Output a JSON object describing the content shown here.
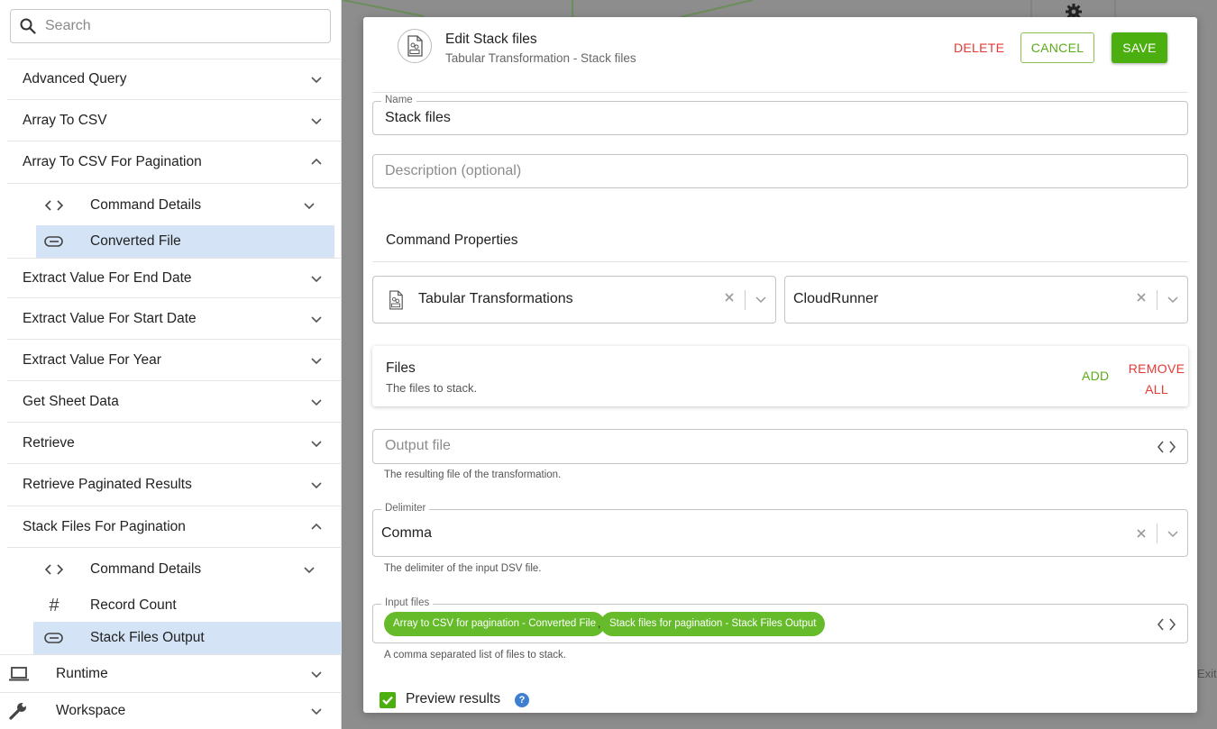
{
  "search": {
    "placeholder": "Search"
  },
  "tree": {
    "items": [
      {
        "label": "Advanced Query"
      },
      {
        "label": "Array To CSV"
      },
      {
        "label": "Array To CSV For Pagination"
      },
      {
        "label": "Command Details"
      },
      {
        "label": "Converted File"
      },
      {
        "label": "Extract Value For End Date"
      },
      {
        "label": "Extract Value For Start Date"
      },
      {
        "label": "Extract Value For Year"
      },
      {
        "label": "Get Sheet Data"
      },
      {
        "label": "Retrieve"
      },
      {
        "label": "Retrieve Paginated Results"
      },
      {
        "label": "Stack Files For Pagination"
      },
      {
        "label": "Command Details"
      },
      {
        "label": "Record Count"
      },
      {
        "label": "Stack Files Output"
      },
      {
        "label": "Runtime"
      },
      {
        "label": "Workspace"
      }
    ]
  },
  "canvas": {
    "exit_label": "Exit"
  },
  "dialog": {
    "title": "Edit Stack files",
    "subtitle": "Tabular Transformation - Stack files",
    "delete_label": "DELETE",
    "cancel_label": "CANCEL",
    "save_label": "SAVE",
    "name": {
      "label": "Name",
      "value": "Stack files"
    },
    "description": {
      "placeholder": "Description (optional)"
    },
    "command_properties_title": "Command Properties",
    "connector": {
      "value": "Tabular Transformations"
    },
    "runner": {
      "value": "CloudRunner"
    },
    "files": {
      "title": "Files",
      "subtitle": "The files to stack.",
      "add_label": "ADD",
      "remove_all_label": "REMOVE ALL"
    },
    "output_file": {
      "placeholder": "Output file",
      "helper": "The resulting file of the transformation."
    },
    "delimiter": {
      "label": "Delimiter",
      "value": "Comma",
      "helper": "The delimiter of the input DSV file."
    },
    "input_files": {
      "label": "Input files",
      "chips": [
        "Array to CSV for pagination - Converted File",
        "Stack files for pagination - Stack Files Output"
      ],
      "separator": ",",
      "helper": "A comma separated list of files to stack."
    },
    "preview": {
      "label": "Preview results",
      "checked": true,
      "help": "?"
    }
  },
  "colors": {
    "accent_green": "#4caf10",
    "danger_red": "#e53935",
    "selection_blue": "#d4e4f6"
  }
}
